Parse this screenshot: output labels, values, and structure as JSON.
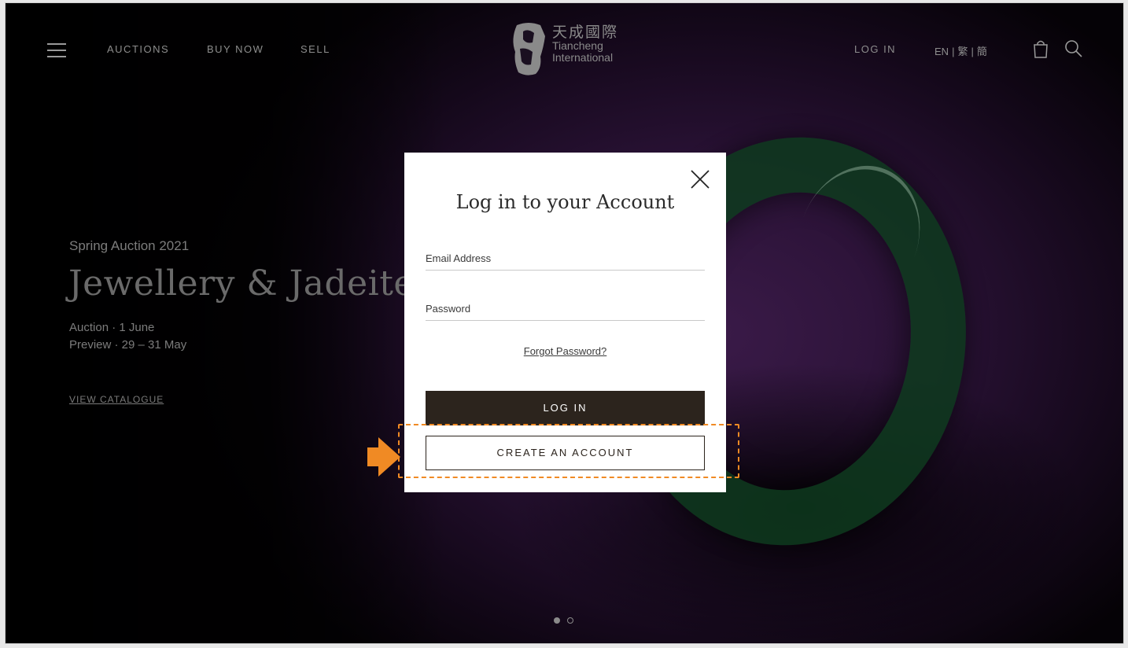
{
  "header": {
    "nav": {
      "auctions": "AUCTIONS",
      "buy_now": "BUY NOW",
      "sell": "SELL"
    },
    "logo": {
      "cn": "天成國際",
      "en_line1": "Tiancheng",
      "en_line2": "International"
    },
    "log_in": "LOG IN",
    "lang": {
      "en": "EN",
      "trad": "繁",
      "simp": "簡",
      "separator": "|"
    },
    "icons": [
      "menu-icon",
      "bag-icon",
      "search-icon"
    ]
  },
  "hero": {
    "eyebrow": "Spring Auction 2021",
    "title": "Jewellery & Jadeite",
    "auction_line": "Auction · 1 June",
    "preview_line": "Preview · 29 – 31 May",
    "link": "VIEW CATALOGUE",
    "slides": {
      "count": 2,
      "active_index": 0
    }
  },
  "modal": {
    "title": "Log in to your Account",
    "email_placeholder": "Email Address",
    "password_placeholder": "Password",
    "forgot": "Forgot Password?",
    "login_button": "LOG IN",
    "create_button": "CREATE AN ACCOUNT"
  },
  "colors": {
    "login_button_bg": "#2c241d",
    "highlight": "#f08a24"
  }
}
